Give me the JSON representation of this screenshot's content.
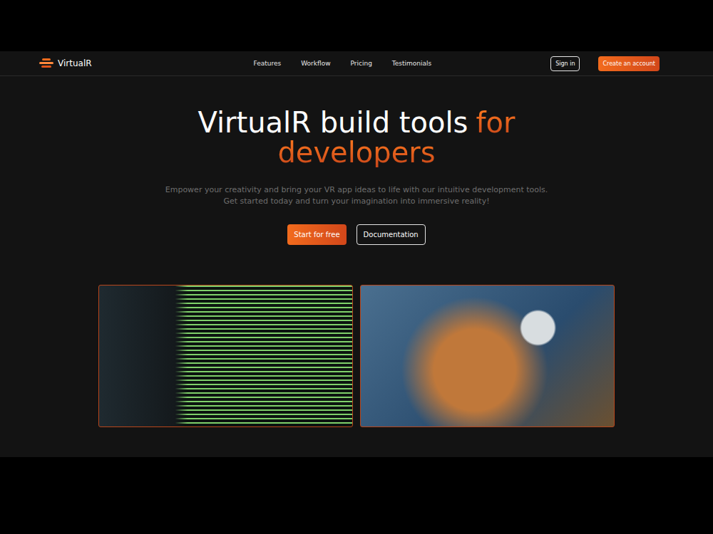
{
  "logo": {
    "name": "VirtualR"
  },
  "nav": {
    "links": [
      "Features",
      "Workflow",
      "Pricing",
      "Testimonials"
    ],
    "sign_in": "Sign in",
    "create_account": "Create an account"
  },
  "hero": {
    "title_lines": [
      [
        {
          "text": "VirtualR build tools",
          "accent": false
        },
        {
          "text": "for",
          "accent": true
        }
      ],
      [
        {
          "text": "developers",
          "accent": true
        }
      ]
    ],
    "subtitle_lines": [
      "Empower your creativity and bring your VR app ideas to life with our intuitive development tools.",
      "Get started today and turn your imagination into immersive reality!"
    ],
    "primary_button": "Start for free",
    "secondary_button": "Documentation"
  }
}
